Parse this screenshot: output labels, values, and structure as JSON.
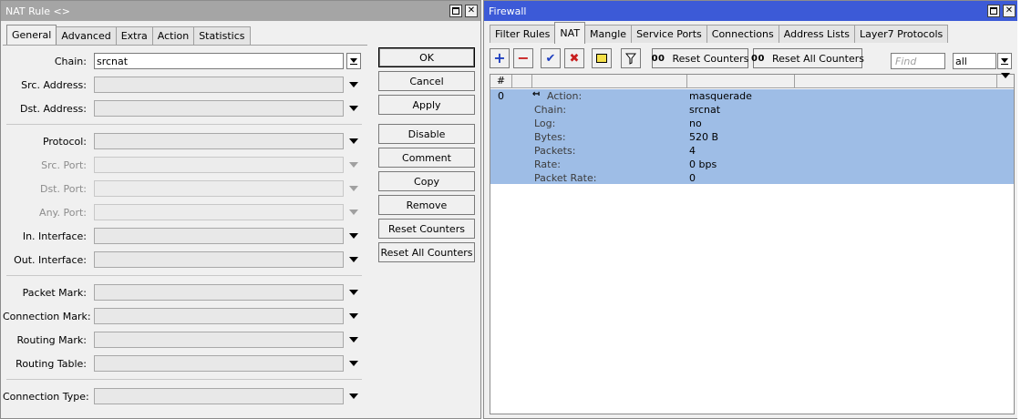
{
  "nat_window": {
    "title": "NAT Rule <>",
    "tabs": [
      "General",
      "Advanced",
      "Extra",
      "Action",
      "Statistics"
    ],
    "fields": {
      "chain": {
        "label": "Chain:",
        "value": "srcnat"
      },
      "src_address": {
        "label": "Src. Address:"
      },
      "dst_address": {
        "label": "Dst. Address:"
      },
      "protocol": {
        "label": "Protocol:"
      },
      "src_port": {
        "label": "Src. Port:"
      },
      "dst_port": {
        "label": "Dst. Port:"
      },
      "any_port": {
        "label": "Any. Port:"
      },
      "in_interface": {
        "label": "In. Interface:"
      },
      "out_interface": {
        "label": "Out. Interface:"
      },
      "packet_mark": {
        "label": "Packet Mark:"
      },
      "connection_mark": {
        "label": "Connection Mark:"
      },
      "routing_mark": {
        "label": "Routing Mark:"
      },
      "routing_table": {
        "label": "Routing Table:"
      },
      "connection_type": {
        "label": "Connection Type:"
      }
    },
    "buttons": {
      "ok": "OK",
      "cancel": "Cancel",
      "apply": "Apply",
      "disable": "Disable",
      "comment": "Comment",
      "copy": "Copy",
      "remove": "Remove",
      "reset_counters": "Reset Counters",
      "reset_all_counters": "Reset All Counters"
    }
  },
  "firewall_window": {
    "title": "Firewall",
    "tabs": [
      "Filter Rules",
      "NAT",
      "Mangle",
      "Service Ports",
      "Connections",
      "Address Lists",
      "Layer7 Protocols"
    ],
    "toolbar": {
      "add_glyph": "+",
      "remove_glyph": "−",
      "enable_glyph": "✔",
      "disable_glyph": "✖",
      "counter_prefix": "00",
      "reset_counters": "Reset Counters",
      "reset_all_counters": "Reset All Counters",
      "find_placeholder": "Find",
      "filter_value": "all"
    },
    "table": {
      "header_hash": "#",
      "row_number": "0",
      "properties": [
        {
          "name": "Action:",
          "value": "masquerade"
        },
        {
          "name": "Chain:",
          "value": "srcnat"
        },
        {
          "name": "Log:",
          "value": "no"
        },
        {
          "name": "Bytes:",
          "value": "520 B"
        },
        {
          "name": "Packets:",
          "value": "4"
        },
        {
          "name": "Rate:",
          "value": "0 bps"
        },
        {
          "name": "Packet Rate:",
          "value": "0"
        }
      ]
    }
  },
  "colors": {
    "firewall_titlebar": "#3c5ad7",
    "inactive_titlebar": "#a5a5a5",
    "selected_row": "#9ebde6"
  }
}
